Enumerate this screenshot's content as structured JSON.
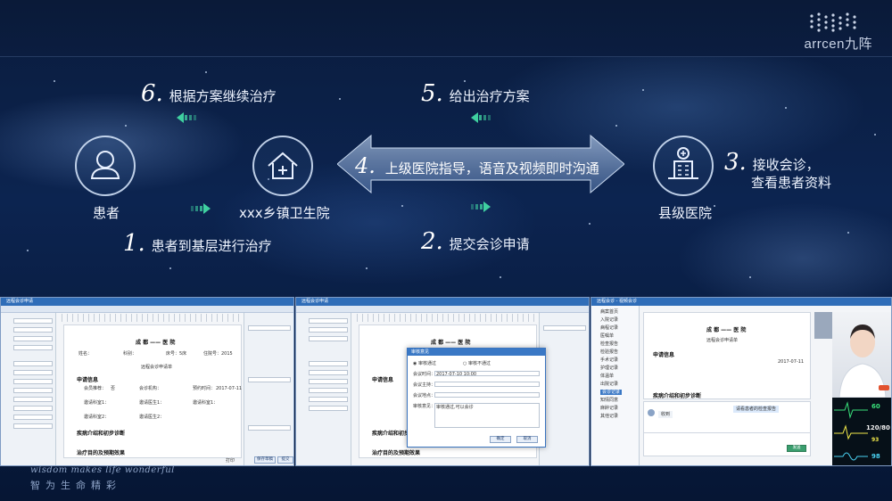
{
  "brand": {
    "logo_text": "arrcen九阵"
  },
  "steps": [
    {
      "num": "1.",
      "text": "患者到基层进行治疗"
    },
    {
      "num": "2.",
      "text": "提交会诊申请"
    },
    {
      "num": "3.",
      "text": "接收会诊，",
      "text2": "查看患者资料"
    },
    {
      "num": "4.",
      "text": "上级医院指导，语音及视频即时沟通"
    },
    {
      "num": "5.",
      "text": "给出治疗方案"
    },
    {
      "num": "6.",
      "text": "根据方案继续治疗"
    }
  ],
  "nodes": {
    "patient": {
      "label": "患者",
      "icon": "person-icon"
    },
    "clinic": {
      "label": "xxx乡镇卫生院",
      "icon": "house-icon"
    },
    "hospital": {
      "label": "县级医院",
      "icon": "hospital-icon"
    }
  },
  "screens": {
    "s1": {
      "title": "远程会诊申请",
      "doc_title": "成 都 —— 医 院",
      "doc_header": [
        "姓名：",
        "科别：",
        "床号：5床",
        "住院号：2015"
      ],
      "form_title": "远程会诊申请单",
      "sections": [
        "申请信息",
        "疾病介绍和初步诊断",
        "治疗目的及预期效果"
      ],
      "rows": [
        {
          "label": "会员推荐：",
          "value": "否"
        },
        {
          "label": "会诊机构：",
          "value": ""
        },
        {
          "label": "预约时间：",
          "value": "2017-07-11"
        },
        {
          "label": "邀请科室1：",
          "value": ""
        },
        {
          "label": "邀请医生1：",
          "value": ""
        },
        {
          "label": "邀请科室2：",
          "value": ""
        },
        {
          "label": "邀请医生2：",
          "value": ""
        }
      ],
      "date": "2017-07-11",
      "buttons": [
        "打印",
        "保存草稿",
        "提交"
      ]
    },
    "s2": {
      "title": "远程会诊申请",
      "dialog_title": "审核意见",
      "radio_pass": "审核通过",
      "radio_fail": "审核不通过",
      "time_label": "会议时间：",
      "time_value": "2017-07-10 10:00",
      "chair_label": "会议主持：",
      "place_label": "会议地点：",
      "opinion_label": "审核意见：",
      "opinion_value": "审核通过,可以会诊",
      "ok": "确定",
      "cancel": "取消"
    },
    "s3": {
      "title": "远程会诊 - 视频会诊",
      "menu": [
        "病案首页",
        "入院记录",
        "病程记录",
        "医嘱单",
        "检查报告",
        "检验报告",
        "手术记录",
        "护理记录",
        "体温单",
        "出院记录",
        "会诊记录",
        "知情同意",
        "麻醉记录",
        "其他记录"
      ],
      "chat_msg": "请看患者的检查报告",
      "reply": "收到",
      "send": "发送",
      "vitals": {
        "hr": "60",
        "bp": "120/80",
        "spo2": "98",
        "rr": "93"
      }
    }
  },
  "footer": {
    "tagline": "wisdom makes life wonderful",
    "slogan": "智为生命精彩"
  },
  "colors": {
    "accent": "#3fd0a0",
    "arrow": "#c8d8ee"
  }
}
